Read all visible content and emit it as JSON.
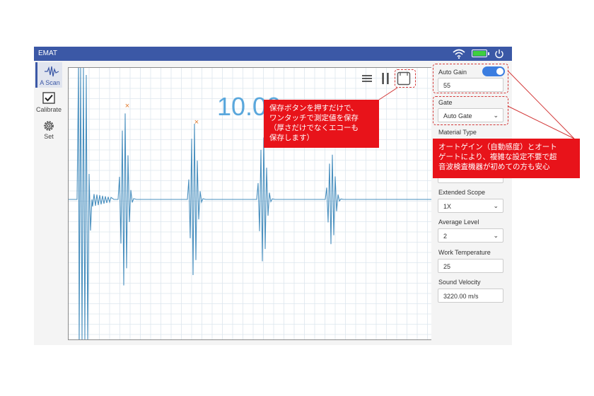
{
  "app": {
    "title": "EMAT"
  },
  "status_icons": [
    "wifi-icon",
    "battery-icon",
    "power-icon"
  ],
  "sidebar": {
    "items": [
      {
        "label": "A Scan",
        "icon": "waveform-icon",
        "active": true
      },
      {
        "label": "Calibrate",
        "icon": "checkbox-icon"
      },
      {
        "label": "Set",
        "icon": "gear-icon"
      }
    ]
  },
  "plot": {
    "readout": "10.00",
    "toolbar_icons": [
      "menu-icon",
      "pause-icon",
      "save-icon"
    ],
    "marker_symbol": "×"
  },
  "panel": {
    "auto_gain": {
      "label": "Auto Gain",
      "enabled": true,
      "value": "55"
    },
    "gate": {
      "label": "Gate",
      "value": "Auto Gate"
    },
    "material_type": {
      "label": "Material Type"
    },
    "extended_scope": {
      "label": "Extended Scope",
      "value": "1X"
    },
    "average_level": {
      "label": "Average Level",
      "value": "2"
    },
    "work_temperature": {
      "label": "Work Temperature",
      "value": "25"
    },
    "sound_velocity": {
      "label": "Sound Velocity",
      "value": "3220.00 m/s"
    }
  },
  "callouts": {
    "save": [
      "保存ボタンを押すだけで、",
      "ワンタッチで測定値を保存",
      "（厚さだけでなくエコーも",
      "保存します）"
    ],
    "auto": [
      "オートゲイン（自動感度）とオート",
      "ゲートにより、複雑な設定不要で超",
      "音波検査機器が初めての方も安心"
    ]
  },
  "colors": {
    "titlebar": "#3b58a6",
    "waveform": "#4a90bf",
    "readout": "#5aa7dc",
    "marker": "#e07a2e",
    "callout": "#e8131a",
    "toggle": "#3b7de0"
  }
}
